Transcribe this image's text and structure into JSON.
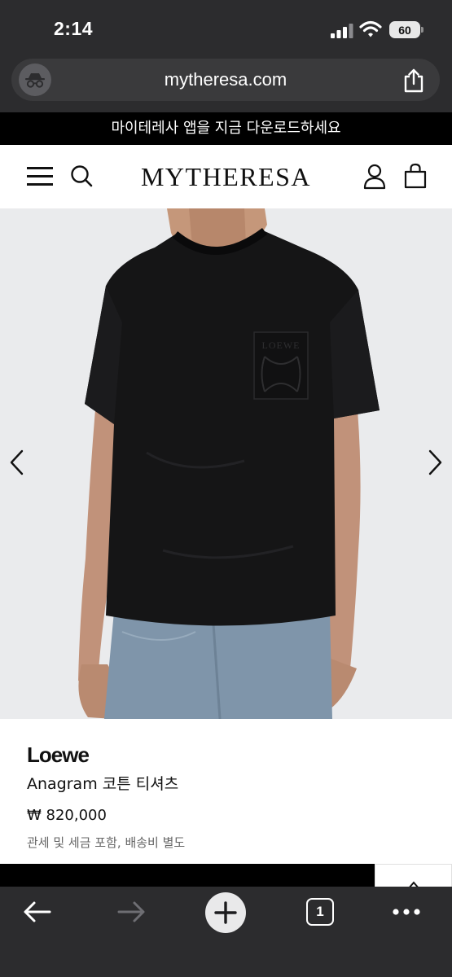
{
  "status_bar": {
    "time": "2:14",
    "battery_level": "60"
  },
  "browser": {
    "url": "mytheresa.com",
    "toolbar": {
      "tab_count": "1"
    }
  },
  "promo_banner": {
    "text": "마이테레사 앱을 지금 다운로드하세요"
  },
  "site_header": {
    "logo": "MYTHERESA"
  },
  "product": {
    "brand": "Loewe",
    "name": "Anagram 코튼 티셔츠",
    "price": "₩ 820,000",
    "tax_note": "관세 및 세금 포함, 배송비 별도",
    "image_pocket_logo": "LOEWE"
  },
  "colors": {
    "chrome": "#2c2c2e",
    "banner": "#000000",
    "image_background": "#eaebed",
    "shirt": "#151516",
    "jeans": "#7f95aa"
  }
}
